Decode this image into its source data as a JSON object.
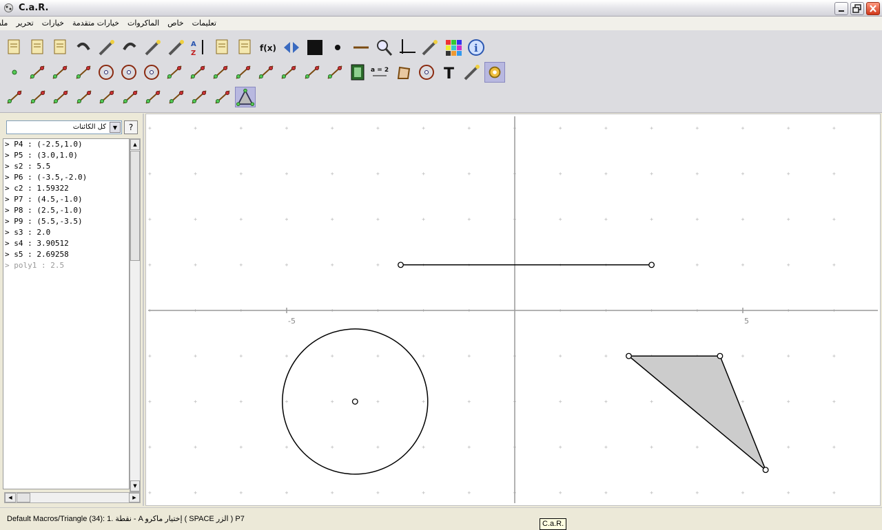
{
  "window": {
    "title": "C.a.R."
  },
  "menu": [
    "ملف",
    "تحرير",
    "خيارات",
    "خيارات متقدمة",
    "الماكروات",
    "خاص",
    "تعليمات"
  ],
  "toolbar": {
    "rows": [
      [
        "new-file-icon",
        "open-file-icon",
        "save-file-icon",
        "undo-icon",
        "delete-icon",
        "redo-icon",
        "wrench-icon",
        "eraser-icon",
        "sort-az-icon",
        "settings-file-icon",
        "clipboard-icon",
        "function-icon",
        "mirror-arrows-icon",
        "black-square-icon",
        "point-style-icon",
        "line-style-icon",
        "zoom-icon",
        "axes-icon",
        "magic-wand-icon",
        "color-grid-icon",
        "info-icon"
      ],
      [
        "point-tool-icon",
        "line-tool-icon",
        "ray-tool-icon",
        "segment-tool-icon",
        "circle-tool-icon",
        "circle-two-tool-icon",
        "circle-fixed-tool-icon",
        "parallel-tool-icon",
        "perpendicular-tool-icon",
        "midpoint-tool-icon",
        "triangle-angle-icon",
        "angle-tool-icon",
        "vector-tool-icon",
        "arc-tool-icon",
        "curve-tool-icon",
        "film-icon",
        "expression-icon",
        "polygon-tool-icon",
        "circle-points-icon",
        "text-tool-icon",
        "wand-tool-icon",
        "gear-macro-icon"
      ],
      [
        "macro-1-icon",
        "macro-2-icon",
        "macro-3-icon",
        "macro-4-icon",
        "macro-5-icon",
        "macro-6-icon",
        "macro-7-icon",
        "macro-8-icon",
        "macro-9-icon",
        "macro-10-icon",
        "macro-triangle-icon"
      ]
    ],
    "expression_label": "a = 2",
    "function_label": "f(x)",
    "text_label": "T"
  },
  "objects_panel": {
    "filter": "كل الكائنات",
    "help": "?",
    "items": [
      "> P4 : (-2.5,1.0)",
      "> P5 : (3.0,1.0)",
      "> s2 : 5.5",
      "> P6 : (-3.5,-2.0)",
      "> c2 : 1.59322",
      "> P7 : (4.5,-1.0)",
      "> P8 : (2.5,-1.0)",
      "> P9 : (5.5,-3.5)",
      "> s3 : 2.0",
      "> s4 : 3.90512",
      "> s5 : 2.69258",
      "> poly1 : 2.5"
    ],
    "hidden_items": [
      "> poly1 : 2.5"
    ]
  },
  "canvas": {
    "axis_labels": {
      "x_neg": "-5",
      "x_pos": "5"
    },
    "segment": {
      "from": [
        -2.5,
        1.0
      ],
      "to": [
        3.0,
        1.0
      ]
    },
    "circle": {
      "center": [
        -3.5,
        -2.0
      ],
      "radius": 1.59322
    },
    "triangle": [
      [
        2.5,
        -1.0
      ],
      [
        4.5,
        -1.0
      ],
      [
        5.5,
        -3.5
      ]
    ],
    "colors": {
      "fill": "#cccccc",
      "stroke": "#000000",
      "grid": "#c8c8c8",
      "axis": "#999999"
    }
  },
  "status": {
    "text": "Default Macros/Triangle (34): 1. نقطة - A  إختيار  ماكرو ( SPACE الزر ) P7",
    "tooltip": "C.a.R."
  }
}
